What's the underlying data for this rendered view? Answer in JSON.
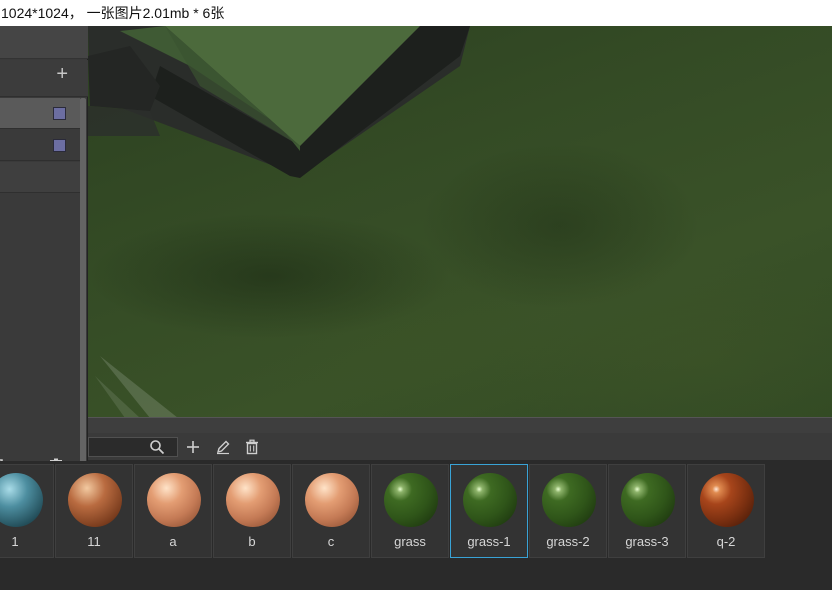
{
  "caption": "1024*1024， 一张图片2.01mb * 6张",
  "icons": {
    "panel_add": "plus-icon",
    "search": "search-icon",
    "add": "plus-icon",
    "edit": "pencil-icon",
    "delete": "trash-icon",
    "folder": "folder-icon"
  },
  "panel": {
    "add_label": "+",
    "rows": [
      {
        "selected": true,
        "swatch_color": "#6c6ea2"
      },
      {
        "selected": false,
        "swatch_color": "#6c6ea2"
      }
    ]
  },
  "search": {
    "value": ""
  },
  "materials": [
    {
      "label": "1",
      "style": "blue"
    },
    {
      "label": "11",
      "style": "copper"
    },
    {
      "label": "a",
      "style": "wood"
    },
    {
      "label": "b",
      "style": "wood"
    },
    {
      "label": "c",
      "style": "wood"
    },
    {
      "label": "grass",
      "style": "grass"
    },
    {
      "label": "grass-1",
      "style": "grass",
      "selected": true
    },
    {
      "label": "grass-2",
      "style": "grass"
    },
    {
      "label": "grass-3",
      "style": "grass"
    },
    {
      "label": "q-2",
      "style": "rust"
    }
  ],
  "colors": {
    "selection": "#39a3d6",
    "panel_bg": "#3a3a3a",
    "strip_bg": "#2a2a2a"
  }
}
